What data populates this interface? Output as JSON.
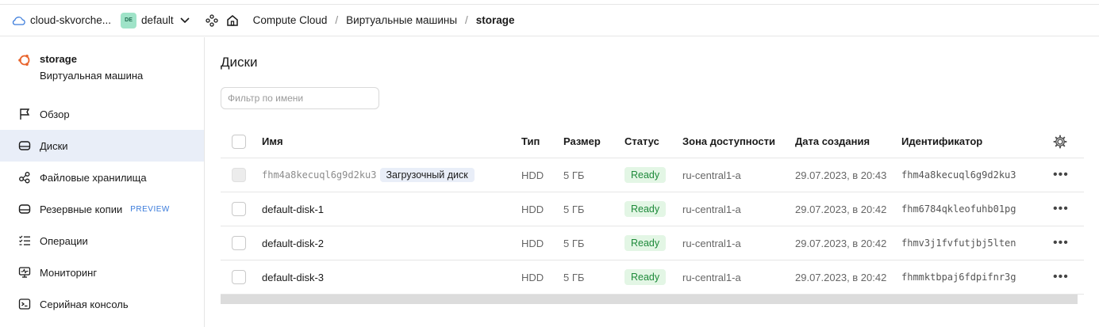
{
  "topbar": {
    "cloud_name": "cloud-skvorche...",
    "folder_badge": "DE",
    "folder_name": "default",
    "breadcrumbs": [
      "Compute Cloud",
      "Виртуальные машины",
      "storage"
    ],
    "separator": "/"
  },
  "sidebar": {
    "vm_title": "storage",
    "vm_subtitle": "Виртуальная машина",
    "items": [
      {
        "label": "Обзор",
        "icon": "flag-icon"
      },
      {
        "label": "Диски",
        "icon": "disk-icon",
        "active": true
      },
      {
        "label": "Файловые хранилища",
        "icon": "share-nodes-icon"
      },
      {
        "label": "Резервные копии",
        "icon": "backup-disk-icon",
        "tag": "PREVIEW"
      },
      {
        "label": "Операции",
        "icon": "list-icon"
      },
      {
        "label": "Мониторинг",
        "icon": "monitor-icon"
      },
      {
        "label": "Серийная консоль",
        "icon": "terminal-icon"
      }
    ]
  },
  "main": {
    "title": "Диски",
    "filter_placeholder": "Фильтр по имени",
    "columns": [
      "Имя",
      "Тип",
      "Размер",
      "Статус",
      "Зона доступности",
      "Дата создания",
      "Идентификатор"
    ],
    "rows": [
      {
        "name": "fhm4a8kecuql6g9d2ku3",
        "boot": "Загрузочный диск",
        "type": "HDD",
        "size": "5 ГБ",
        "status": "Ready",
        "zone": "ru-central1-a",
        "created": "29.07.2023, в 20:43",
        "id": "fhm4a8kecuql6g9d2ku3"
      },
      {
        "name": "default-disk-1",
        "type": "HDD",
        "size": "5 ГБ",
        "status": "Ready",
        "zone": "ru-central1-a",
        "created": "29.07.2023, в 20:42",
        "id": "fhm6784qkleofuhb01pg"
      },
      {
        "name": "default-disk-2",
        "type": "HDD",
        "size": "5 ГБ",
        "status": "Ready",
        "zone": "ru-central1-a",
        "created": "29.07.2023, в 20:42",
        "id": "fhmv3j1fvfutjbj5lten"
      },
      {
        "name": "default-disk-3",
        "type": "HDD",
        "size": "5 ГБ",
        "status": "Ready",
        "zone": "ru-central1-a",
        "created": "29.07.2023, в 20:42",
        "id": "fhmmktbpaj6fdpifnr3g"
      }
    ],
    "row_actions": "•••"
  },
  "colors": {
    "accent": "#3a7bdb",
    "active_bg": "#e9eef8",
    "status_bg": "#e3f6e5",
    "status_text": "#1e8a3a",
    "vm_icon": "#e8642c"
  }
}
